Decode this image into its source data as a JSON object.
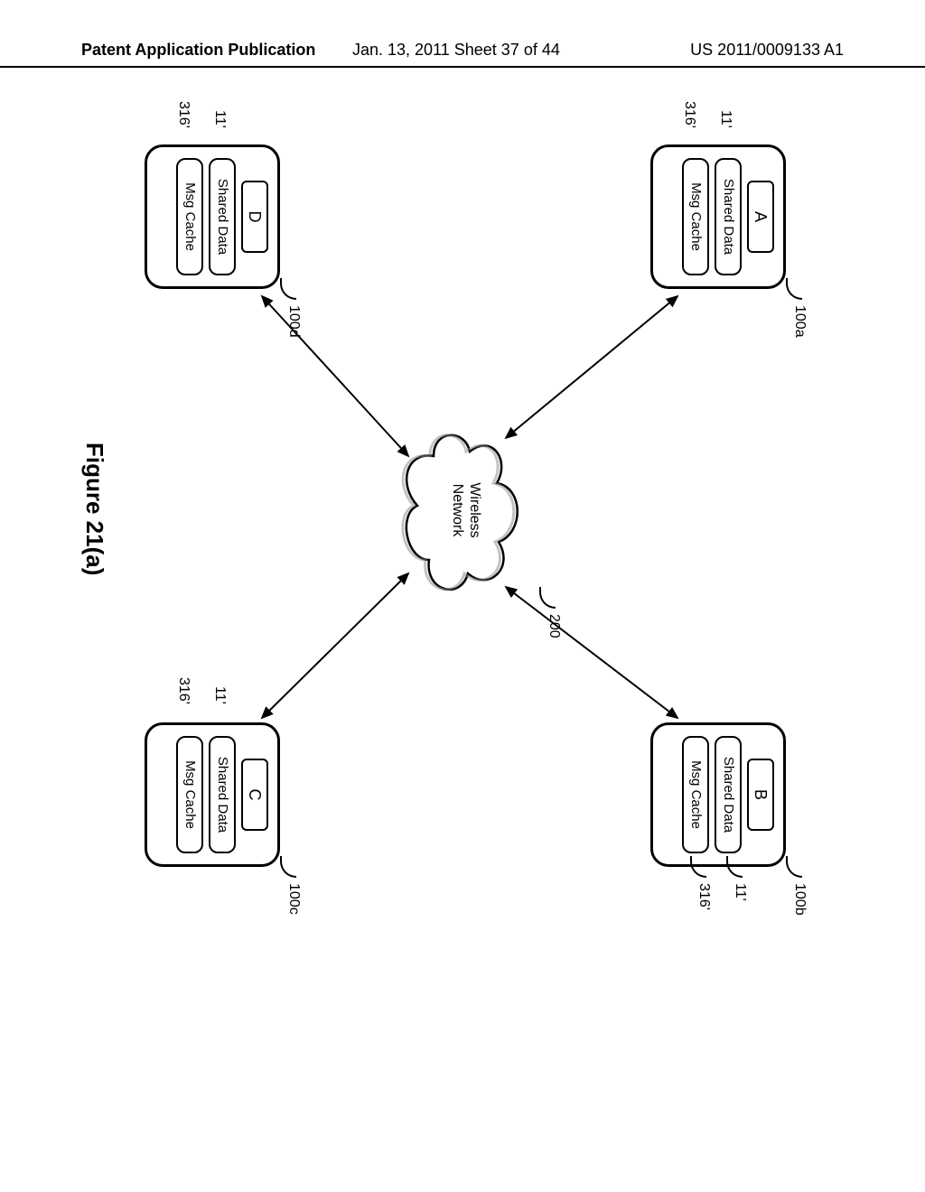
{
  "header": {
    "left": "Patent Application Publication",
    "center": "Jan. 13, 2011  Sheet 37 of 44",
    "right": "US 2011/0009133 A1"
  },
  "figure_caption": "Figure 21(a)",
  "cloud": {
    "label_line1": "Wireless",
    "label_line2": "Network",
    "ref": "200"
  },
  "devices": {
    "a": {
      "label": "A",
      "shared": "Shared Data",
      "cache": "Msg Cache",
      "ref_main": "100a",
      "ref_shared": "11'",
      "ref_cache": "316'"
    },
    "b": {
      "label": "B",
      "shared": "Shared Data",
      "cache": "Msg Cache",
      "ref_main": "100b",
      "ref_shared": "11'",
      "ref_cache": "316'"
    },
    "c": {
      "label": "C",
      "shared": "Shared Data",
      "cache": "Msg Cache",
      "ref_main": "100c",
      "ref_shared": "11'",
      "ref_cache": "316'"
    },
    "d": {
      "label": "D",
      "shared": "Shared Data",
      "cache": "Msg Cache",
      "ref_main": "100d",
      "ref_shared": "11'",
      "ref_cache": "316'"
    }
  }
}
